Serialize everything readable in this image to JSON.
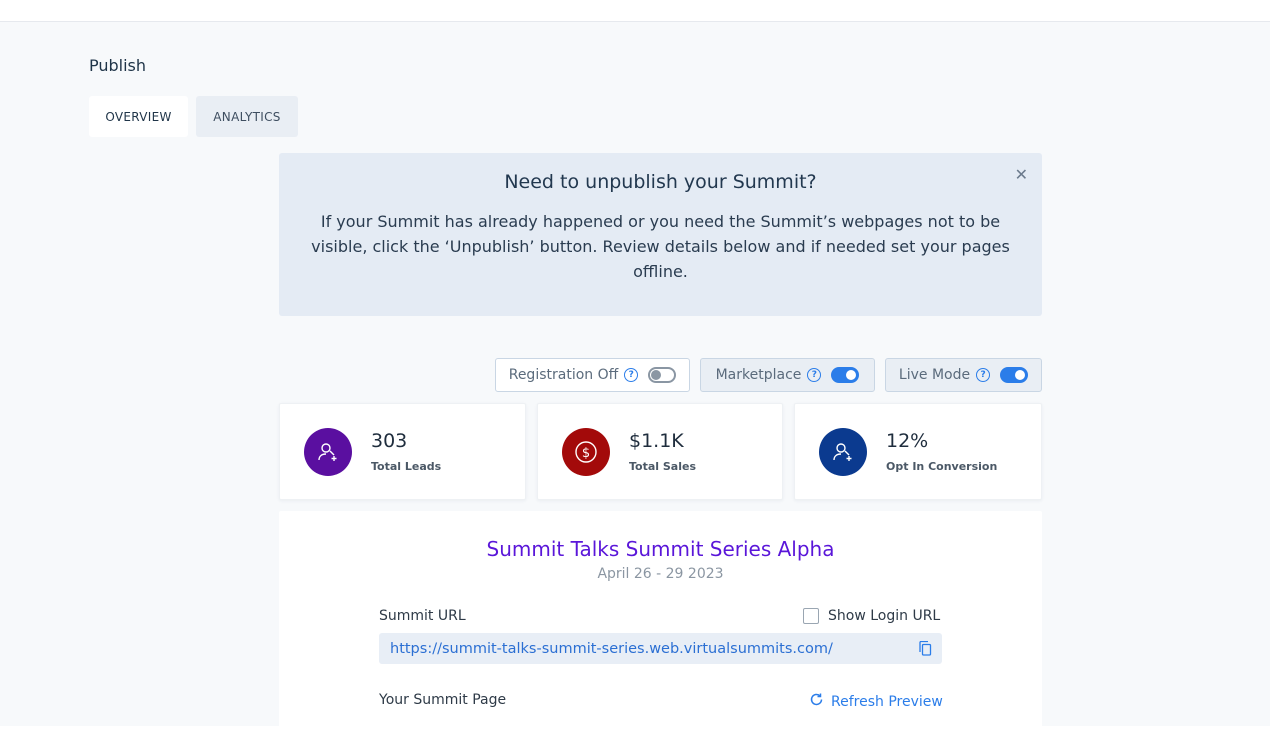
{
  "page": {
    "title": "Publish"
  },
  "tabs": [
    {
      "label": "OVERVIEW",
      "active": true
    },
    {
      "label": "ANALYTICS",
      "active": false
    }
  ],
  "notice": {
    "title": "Need to unpublish your Summit?",
    "body": "If your Summit has already happened or you need the Summit’s webpages not to be visible, click the ‘Unpublish’ button. Review details below and if needed set your pages offline.",
    "close_icon": "close-icon"
  },
  "toggles": [
    {
      "label": "Registration Off",
      "on": false
    },
    {
      "label": "Marketplace",
      "on": true
    },
    {
      "label": "Live Mode",
      "on": true
    }
  ],
  "stats": [
    {
      "value": "303",
      "label": "Total Leads",
      "icon": "user-add-icon",
      "color": "#5a0fa0"
    },
    {
      "value": "$1.1K",
      "label": "Total Sales",
      "icon": "dollar-icon",
      "color": "#a30a0a"
    },
    {
      "value": "12%",
      "label": "Opt In Conversion",
      "icon": "user-add-icon",
      "color": "#0b3a8f"
    }
  ],
  "summit": {
    "name": "Summit Talks Summit Series Alpha",
    "dates": "April 26 - 29 2023",
    "url_label": "Summit URL",
    "show_login_label": "Show Login URL",
    "show_login_checked": false,
    "url": "https://summit-talks-summit-series.web.virtualsummits.com/",
    "page_label": "Your Summit Page",
    "refresh_label": "Refresh Preview"
  },
  "colors": {
    "accent": "#2b7de9",
    "summit_name": "#5a16d9",
    "preview_bar": "#ff6a13"
  }
}
